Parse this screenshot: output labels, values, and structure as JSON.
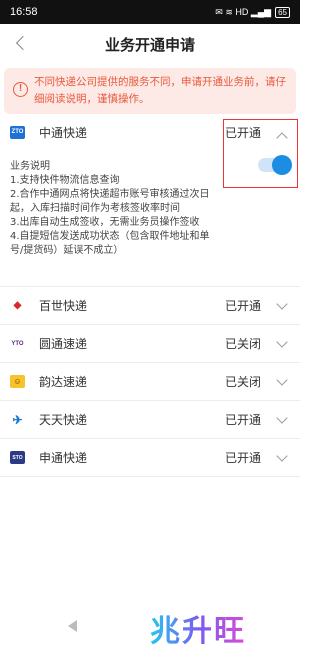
{
  "status_bar": {
    "time": "16:58",
    "indicators": "✉ ≋ HD ▂▄▆",
    "battery": "65"
  },
  "header": {
    "title": "业务开通申请"
  },
  "notice": {
    "text": "不同快递公司提供的服务不同，申请开通业务前，请仔细阅读说明，谨慎操作。",
    "icon": "!"
  },
  "companies": [
    {
      "name": "中通快递",
      "status": "已开通",
      "logo": "ZTO",
      "expanded": true,
      "toggle_on": true,
      "description": {
        "heading": "业务说明",
        "lines": [
          "1.支持快件物流信息查询",
          "2.合作中通网点将快递超市账号审核通过次日起，入库扫描时间作为考核签收率时间",
          "3.出库自动生成签收，无需业务员操作签收",
          "4.自提短信发送成功状态（包含取件地址和单号/提货码）延误不成立）"
        ]
      }
    },
    {
      "name": "百世快递",
      "status": "已开通",
      "logo": "◆"
    },
    {
      "name": "圆通速递",
      "status": "已关闭",
      "logo": "YTO"
    },
    {
      "name": "韵达速递",
      "status": "已关闭",
      "logo": "☺"
    },
    {
      "name": "天天快递",
      "status": "已开通",
      "logo": "✈"
    },
    {
      "name": "申通快递",
      "status": "已开通",
      "logo": "STO"
    }
  ],
  "watermark": "兆升旺"
}
